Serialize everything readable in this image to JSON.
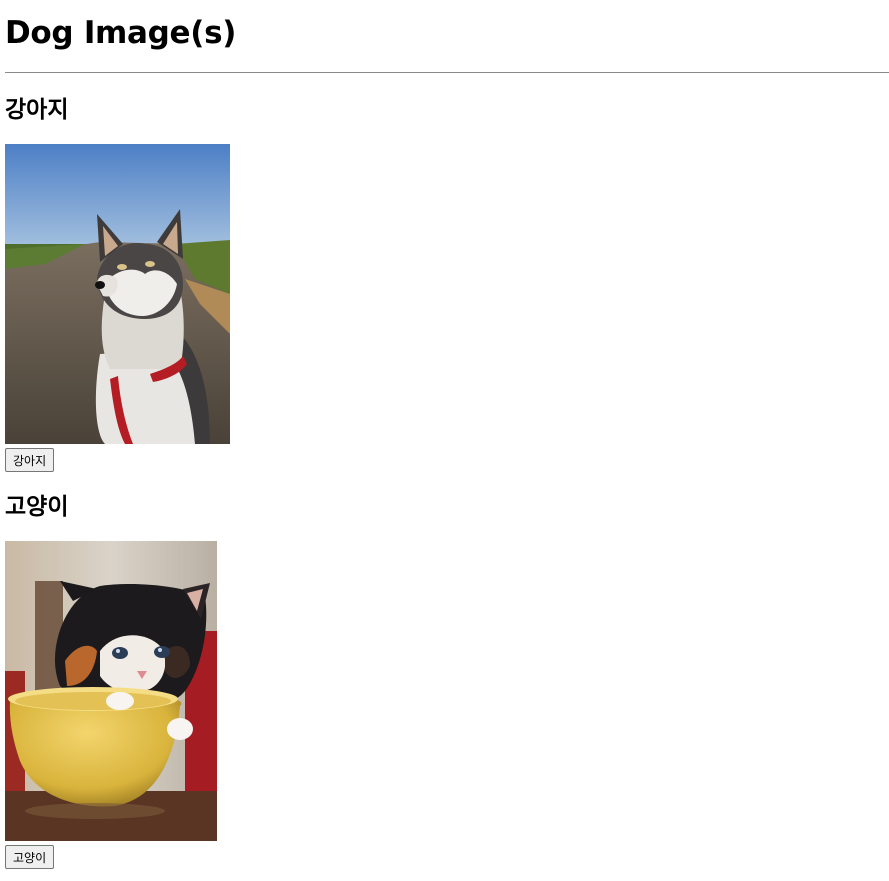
{
  "page": {
    "title": "Dog Image(s)"
  },
  "sections": [
    {
      "heading": "강아지",
      "image_subject": "husky-dog-photo",
      "button_label": "강아지"
    },
    {
      "heading": "고양이",
      "image_subject": "kitten-in-cup-photo",
      "button_label": "고양이"
    }
  ]
}
